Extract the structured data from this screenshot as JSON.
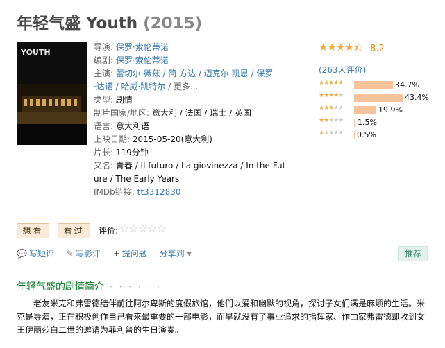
{
  "movie": {
    "title_cn": "年轻气盛",
    "title_en": "Youth",
    "year": "(2015)",
    "poster_text": "YOUTH"
  },
  "info": {
    "director_label": "导演:",
    "director": "保罗·索伦蒂诺",
    "writer_label": "编剧:",
    "writer": "保罗·索伦蒂诺",
    "cast_label": "主演:",
    "cast_line1": "蕾切尔·薇兹 / 简·方达 / 迈克尔·凯恩 / 保罗",
    "cast_line2": "·达诺 / 哈威·凯特尔",
    "cast_more": " / 更多...",
    "genre_label": "类型:",
    "genre": "剧情",
    "country_label": "制片国家/地区:",
    "country": "意大利 / 法国 / 瑞士 / 英国",
    "language_label": "语言:",
    "language": "意大利语",
    "release_label": "上映日期:",
    "release": "2015-05-20(意大利)",
    "runtime_label": "片长:",
    "runtime": "119分钟",
    "aka_label": "又名:",
    "aka_line1": "青春 / Il futuro / La giovinezza / In the Fut",
    "aka_line2": "ure / The Early Years",
    "imdb_label": "IMDb链接:",
    "imdb": "tt3312830"
  },
  "rating": {
    "score": "8.2",
    "stars_shown": 4.5,
    "count_text": "(263人评价)",
    "distribution": [
      {
        "stars": 5,
        "percent": 34.7,
        "label": "34.7%"
      },
      {
        "stars": 4,
        "percent": 43.4,
        "label": "43.4%"
      },
      {
        "stars": 3,
        "percent": 19.9,
        "label": "19.9%"
      },
      {
        "stars": 2,
        "percent": 1.5,
        "label": "1.5%"
      },
      {
        "stars": 1,
        "percent": 0.5,
        "label": "0.5%"
      }
    ]
  },
  "actions": {
    "want": "想看",
    "seen": "看过",
    "rate_label": "评价:",
    "short_review": "写短评",
    "review": "写影评",
    "ask": "提问题",
    "share": "分享到",
    "recommend": "推荐"
  },
  "summary": {
    "title": "年轻气盛的剧情简介",
    "dots": "· · · · · ·",
    "text": "老友米克和弗雷德结伴前往阿尔卑斯的度假旅馆，他们以爱和幽默的视角，探讨子女们满是麻烦的生活。米克是导演，正在积极创作自己看来最重要的一部电影，而早就没有了事业追求的指挥家、作曲家弗雷德却收到女王伊丽莎白二世的邀请为菲利普的生日演奏。"
  },
  "colors": {
    "link": "#3377aa",
    "star": "#f4a93b",
    "bar": "#f7c39b",
    "section_green": "#007722"
  }
}
